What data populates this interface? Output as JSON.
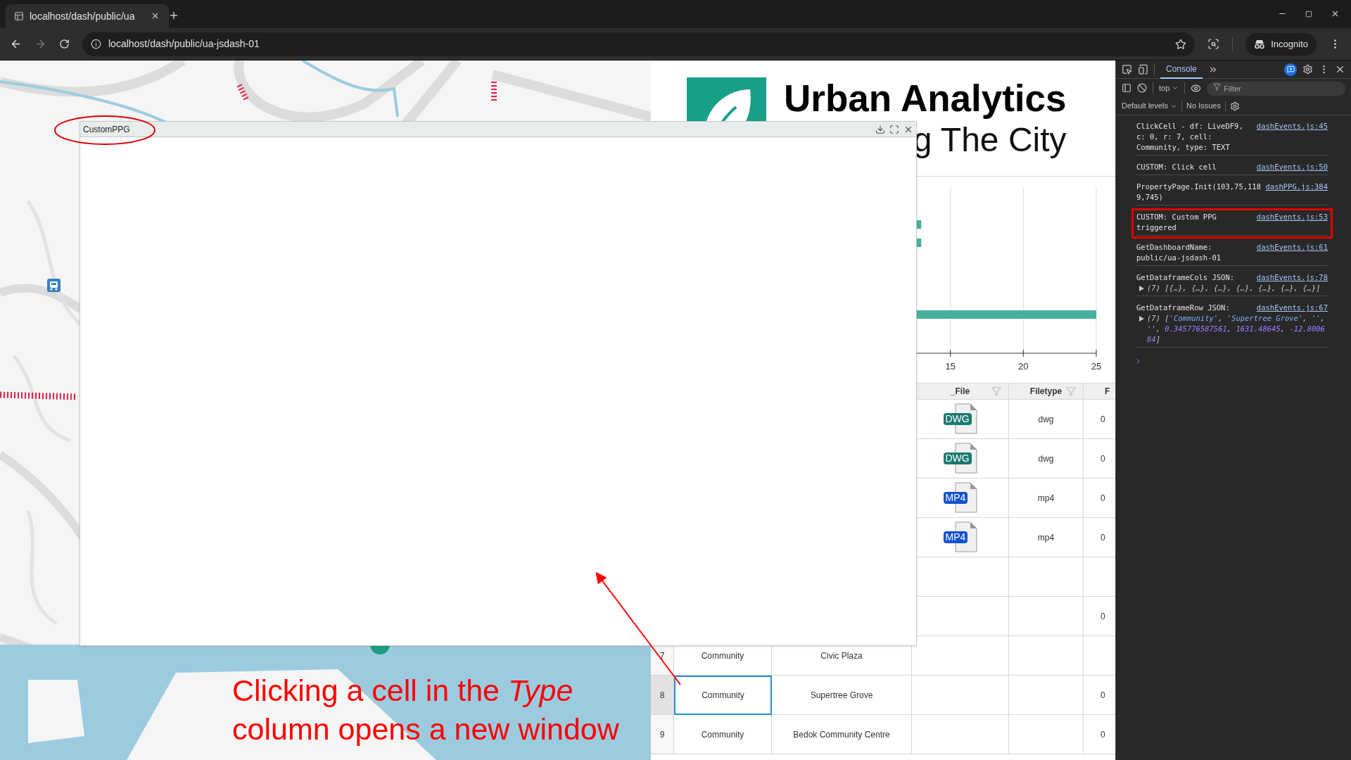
{
  "browser": {
    "tab": {
      "title": "localhost/dash/public/ua"
    },
    "address": "localhost/dash/public/ua-jsdash-01",
    "forward_disabled": true,
    "profile": "Incognito"
  },
  "logo": {
    "title": "Urban Analytics",
    "subtitle": "g The City"
  },
  "chart_data": {
    "type": "bar",
    "orientation": "horizontal",
    "values": [
      13,
      13,
      25
    ],
    "xlim": [
      12.7,
      25
    ],
    "xticks": [
      15,
      20,
      25
    ]
  },
  "table": {
    "columns": {
      "file": "_File",
      "filetype": "Filetype",
      "column_6": "F"
    },
    "rows": [
      {
        "file": {
          "label": "DWG",
          "color": "#1a7a70"
        },
        "filetype": "dwg",
        "column_6": "0"
      },
      {
        "file": {
          "label": "DWG",
          "color": "#1a7a70"
        },
        "filetype": "dwg",
        "column_6": "0"
      },
      {
        "file": {
          "label": "MP4",
          "color": "#1252d0"
        },
        "filetype": "mp4",
        "column_6": "0"
      },
      {
        "file": {
          "label": "MP4",
          "color": "#1252d0"
        },
        "filetype": "mp4",
        "column_6": "0"
      },
      {},
      {
        "column_6": "0"
      },
      {
        "number": "7",
        "type": "Community",
        "name": "Civic Plaza",
        "selected": false
      },
      {
        "number": "8",
        "type": "Community",
        "name": "Supertree Grove",
        "column_6": "0",
        "selected": true
      },
      {
        "number": "9",
        "type": "Community",
        "name": "Bedok Community Centre",
        "column_6": "0",
        "selected": false
      }
    ]
  },
  "popup": {
    "title": "CustomPPG"
  },
  "annotation": {
    "text": "Clicking a cell in the *Type* column opens a new window"
  },
  "devtools": {
    "tabs": [
      {
        "label": "Console",
        "selected": true
      }
    ],
    "context": "top",
    "filter_placeholder": "Filter",
    "levels": "Default levels",
    "issues": "No Issues",
    "messages": [
      {
        "text": "ClickCell - df: LiveDF9, c: 0, r: 7, cell: Community, type: TEXT",
        "source": "dashEvents.js:45",
        "highlighted": false
      },
      {
        "text": "CUSTOM: Click cell",
        "source": "dashEvents.js:50",
        "highlighted": false
      },
      {
        "text": "PropertyPage.Init(103,75,1189,745)",
        "source": "dashPPG.js:384",
        "highlighted": false
      },
      {
        "text": "CUSTOM: Custom PPG triggered",
        "source": "dashEvents.js:53",
        "highlighted": true
      },
      {
        "text": "GetDashboardName: public/ua-jsdash-01",
        "source": "dashEvents.js:61",
        "highlighted": false
      },
      {
        "text": "GetDataframeCols JSON:",
        "source": "dashEvents.js:78",
        "highlighted": false,
        "expanded": false,
        "preview": [
          {
            "kind": "plain",
            "text": "(7) [{…}, {…}, {…}, {…}, {…}, {…}, {…}]"
          }
        ]
      },
      {
        "text": "GetDataframeRow JSON:",
        "source": "dashEvents.js:67",
        "highlighted": false,
        "expanded": false,
        "preview": [
          {
            "kind": "plain",
            "text": "(7) ["
          },
          {
            "kind": "string",
            "text": "'Community'"
          },
          {
            "kind": "plain",
            "text": ", "
          },
          {
            "kind": "string",
            "text": "'Supertree Grove'"
          },
          {
            "kind": "plain",
            "text": ", "
          },
          {
            "kind": "string",
            "text": "''"
          },
          {
            "kind": "plain",
            "text": ", "
          },
          {
            "kind": "string",
            "text": "''"
          },
          {
            "kind": "plain",
            "text": ", "
          },
          {
            "kind": "number",
            "text": "0.345776587561"
          },
          {
            "kind": "plain",
            "text": ", "
          },
          {
            "kind": "number",
            "text": "1631.48645"
          },
          {
            "kind": "plain",
            "text": ", "
          },
          {
            "kind": "number",
            "text": "-12.800684"
          },
          {
            "kind": "plain",
            "text": "]"
          }
        ]
      }
    ]
  }
}
